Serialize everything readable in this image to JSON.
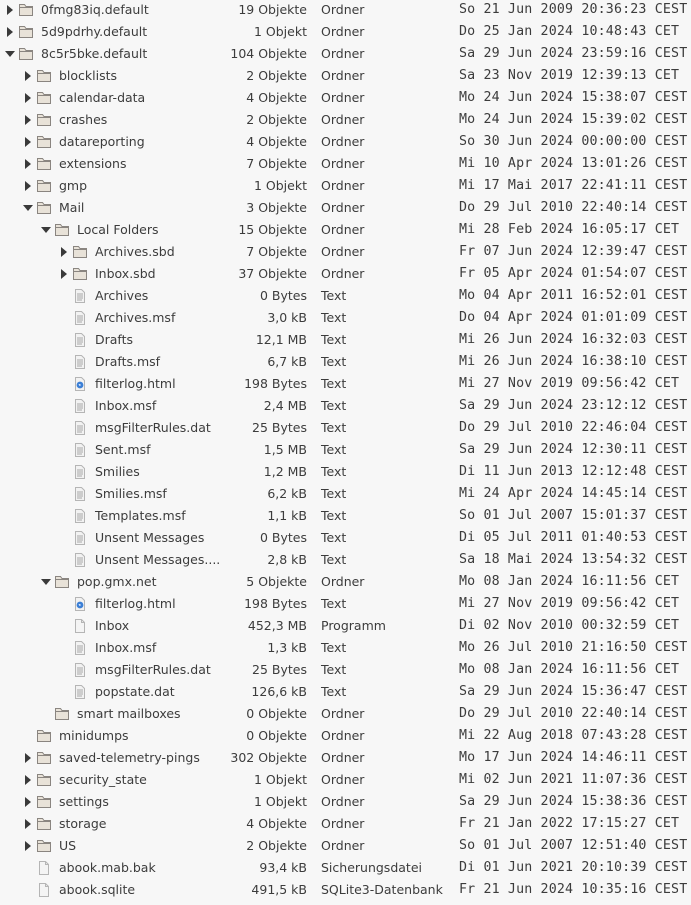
{
  "colors": {
    "background": "#f7f7f7",
    "text": "#3c3c3c",
    "folder": "#e8e2d8",
    "folder_stroke": "#8a8580",
    "html_icon": "#3b7fd6"
  },
  "rows": [
    {
      "level": 0,
      "expander": "closed",
      "icon": "folder",
      "name": "0fmg83iq.default",
      "size": "19 Objekte",
      "type": "Ordner",
      "date": "So 21 Jun 2009 20:36:23 CEST"
    },
    {
      "level": 0,
      "expander": "closed",
      "icon": "folder",
      "name": "5d9pdrhy.default",
      "size": "1 Objekt",
      "type": "Ordner",
      "date": "Do 25 Jan 2024 10:48:43 CET"
    },
    {
      "level": 0,
      "expander": "open",
      "icon": "folder",
      "name": "8c5r5bke.default",
      "size": "104 Objekte",
      "type": "Ordner",
      "date": "Sa 29 Jun 2024 23:59:16 CEST"
    },
    {
      "level": 1,
      "expander": "closed",
      "icon": "folder",
      "name": "blocklists",
      "size": "2 Objekte",
      "type": "Ordner",
      "date": "Sa 23 Nov 2019 12:39:13 CET"
    },
    {
      "level": 1,
      "expander": "closed",
      "icon": "folder",
      "name": "calendar-data",
      "size": "4 Objekte",
      "type": "Ordner",
      "date": "Mo 24 Jun 2024 15:38:07 CEST"
    },
    {
      "level": 1,
      "expander": "closed",
      "icon": "folder",
      "name": "crashes",
      "size": "2 Objekte",
      "type": "Ordner",
      "date": "Mo 24 Jun 2024 15:39:02 CEST"
    },
    {
      "level": 1,
      "expander": "closed",
      "icon": "folder",
      "name": "datareporting",
      "size": "4 Objekte",
      "type": "Ordner",
      "date": "So 30 Jun 2024 00:00:00 CEST"
    },
    {
      "level": 1,
      "expander": "closed",
      "icon": "folder",
      "name": "extensions",
      "size": "7 Objekte",
      "type": "Ordner",
      "date": "Mi 10 Apr 2024 13:01:26 CEST"
    },
    {
      "level": 1,
      "expander": "closed",
      "icon": "folder",
      "name": "gmp",
      "size": "1 Objekt",
      "type": "Ordner",
      "date": "Mi 17 Mai 2017 22:41:11 CEST"
    },
    {
      "level": 1,
      "expander": "open",
      "icon": "folder",
      "name": "Mail",
      "size": "3 Objekte",
      "type": "Ordner",
      "date": "Do 29 Jul 2010 22:40:14 CEST"
    },
    {
      "level": 2,
      "expander": "open",
      "icon": "folder",
      "name": "Local Folders",
      "size": "15 Objekte",
      "type": "Ordner",
      "date": "Mi 28 Feb 2024 16:05:17 CET"
    },
    {
      "level": 3,
      "expander": "closed",
      "icon": "folder",
      "name": "Archives.sbd",
      "size": "7 Objekte",
      "type": "Ordner",
      "date": "Fr 07 Jun 2024 12:39:47 CEST"
    },
    {
      "level": 3,
      "expander": "closed",
      "icon": "folder",
      "name": "Inbox.sbd",
      "size": "37 Objekte",
      "type": "Ordner",
      "date": "Fr 05 Apr 2024 01:54:07 CEST"
    },
    {
      "level": 3,
      "expander": "none",
      "icon": "text",
      "name": "Archives",
      "size": "0 Bytes",
      "type": "Text",
      "date": "Mo 04 Apr 2011 16:52:01 CEST"
    },
    {
      "level": 3,
      "expander": "none",
      "icon": "text",
      "name": "Archives.msf",
      "size": "3,0 kB",
      "type": "Text",
      "date": "Do 04 Apr 2024 01:01:09 CEST"
    },
    {
      "level": 3,
      "expander": "none",
      "icon": "text",
      "name": "Drafts",
      "size": "12,1 MB",
      "type": "Text",
      "date": "Mi 26 Jun 2024 16:32:03 CEST"
    },
    {
      "level": 3,
      "expander": "none",
      "icon": "text",
      "name": "Drafts.msf",
      "size": "6,7 kB",
      "type": "Text",
      "date": "Mi 26 Jun 2024 16:38:10 CEST"
    },
    {
      "level": 3,
      "expander": "none",
      "icon": "html",
      "name": "filterlog.html",
      "size": "198 Bytes",
      "type": "Text",
      "date": "Mi 27 Nov 2019 09:56:42 CET"
    },
    {
      "level": 3,
      "expander": "none",
      "icon": "text",
      "name": "Inbox.msf",
      "size": "2,4 MB",
      "type": "Text",
      "date": "Sa 29 Jun 2024 23:12:12 CEST"
    },
    {
      "level": 3,
      "expander": "none",
      "icon": "text",
      "name": "msgFilterRules.dat",
      "size": "25 Bytes",
      "type": "Text",
      "date": "Do 29 Jul 2010 22:46:04 CEST"
    },
    {
      "level": 3,
      "expander": "none",
      "icon": "text",
      "name": "Sent.msf",
      "size": "1,5 MB",
      "type": "Text",
      "date": "Sa 29 Jun 2024 12:30:11 CEST"
    },
    {
      "level": 3,
      "expander": "none",
      "icon": "text",
      "name": "Smilies",
      "size": "1,2 MB",
      "type": "Text",
      "date": "Di 11 Jun 2013 12:12:48 CEST"
    },
    {
      "level": 3,
      "expander": "none",
      "icon": "text",
      "name": "Smilies.msf",
      "size": "6,2 kB",
      "type": "Text",
      "date": "Mi 24 Apr 2024 14:45:14 CEST"
    },
    {
      "level": 3,
      "expander": "none",
      "icon": "text",
      "name": "Templates.msf",
      "size": "1,1 kB",
      "type": "Text",
      "date": "So 01 Jul 2007 15:01:37 CEST"
    },
    {
      "level": 3,
      "expander": "none",
      "icon": "text",
      "name": "Unsent Messages",
      "size": "0 Bytes",
      "type": "Text",
      "date": "Di 05 Jul 2011 01:40:53 CEST"
    },
    {
      "level": 3,
      "expander": "none",
      "icon": "text",
      "name": "Unsent Messages....",
      "size": "2,8 kB",
      "type": "Text",
      "date": "Sa 18 Mai 2024 13:54:32 CEST"
    },
    {
      "level": 2,
      "expander": "open",
      "icon": "folder",
      "name": "pop.gmx.net",
      "size": "5 Objekte",
      "type": "Ordner",
      "date": "Mo 08 Jan 2024 16:11:56 CET"
    },
    {
      "level": 3,
      "expander": "none",
      "icon": "html",
      "name": "filterlog.html",
      "size": "198 Bytes",
      "type": "Text",
      "date": "Mi 27 Nov 2019 09:56:42 CET"
    },
    {
      "level": 3,
      "expander": "none",
      "icon": "blank",
      "name": "Inbox",
      "size": "452,3 MB",
      "type": "Programm",
      "date": "Di 02 Nov 2010 00:32:59 CET"
    },
    {
      "level": 3,
      "expander": "none",
      "icon": "text",
      "name": "Inbox.msf",
      "size": "1,3 kB",
      "type": "Text",
      "date": "Mo 26 Jul 2010 21:16:50 CEST"
    },
    {
      "level": 3,
      "expander": "none",
      "icon": "text",
      "name": "msgFilterRules.dat",
      "size": "25 Bytes",
      "type": "Text",
      "date": "Mo 08 Jan 2024 16:11:56 CET"
    },
    {
      "level": 3,
      "expander": "none",
      "icon": "text",
      "name": "popstate.dat",
      "size": "126,6 kB",
      "type": "Text",
      "date": "Sa 29 Jun 2024 15:36:47 CEST"
    },
    {
      "level": 2,
      "expander": "none",
      "icon": "folder",
      "name": "smart mailboxes",
      "size": "0 Objekte",
      "type": "Ordner",
      "date": "Do 29 Jul 2010 22:40:14 CEST"
    },
    {
      "level": 1,
      "expander": "none",
      "icon": "folder",
      "name": "minidumps",
      "size": "0 Objekte",
      "type": "Ordner",
      "date": "Mi 22 Aug 2018 07:43:28 CEST"
    },
    {
      "level": 1,
      "expander": "closed",
      "icon": "folder",
      "name": "saved-telemetry-pings",
      "size": "302 Objekte",
      "type": "Ordner",
      "date": "Mo 17 Jun 2024 14:46:11 CEST"
    },
    {
      "level": 1,
      "expander": "closed",
      "icon": "folder",
      "name": "security_state",
      "size": "1 Objekt",
      "type": "Ordner",
      "date": "Mi 02 Jun 2021 11:07:36 CEST"
    },
    {
      "level": 1,
      "expander": "closed",
      "icon": "folder",
      "name": "settings",
      "size": "1 Objekt",
      "type": "Ordner",
      "date": "Sa 29 Jun 2024 15:38:36 CEST"
    },
    {
      "level": 1,
      "expander": "closed",
      "icon": "folder",
      "name": "storage",
      "size": "4 Objekte",
      "type": "Ordner",
      "date": "Fr 21 Jan 2022 17:15:27 CET"
    },
    {
      "level": 1,
      "expander": "closed",
      "icon": "folder",
      "name": "US",
      "size": "2 Objekte",
      "type": "Ordner",
      "date": "So 01 Jul 2007 12:51:40 CEST"
    },
    {
      "level": 1,
      "expander": "none",
      "icon": "blank",
      "name": "abook.mab.bak",
      "size": "93,4 kB",
      "type": "Sicherungsdatei",
      "date": "Di 01 Jun 2021 20:10:39 CEST"
    },
    {
      "level": 1,
      "expander": "none",
      "icon": "blank",
      "name": "abook.sqlite",
      "size": "491,5 kB",
      "type": "SQLite3-Datenbank",
      "date": "Fr 21 Jun 2024 10:35:16 CEST"
    }
  ]
}
